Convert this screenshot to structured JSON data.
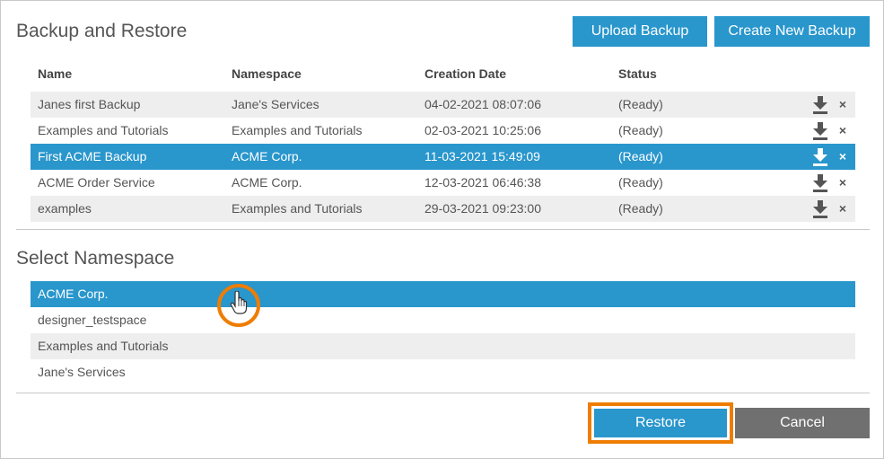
{
  "dialog": {
    "title": "Backup and Restore",
    "upload_label": "Upload Backup",
    "create_label": "Create New Backup"
  },
  "backups": {
    "headers": {
      "name": "Name",
      "namespace": "Namespace",
      "date": "Creation Date",
      "status": "Status"
    },
    "rows": [
      {
        "name": "Janes first Backup",
        "namespace": "Jane's Services",
        "date": "04-02-2021 08:07:06",
        "status": "(Ready)"
      },
      {
        "name": "Examples and Tutorials",
        "namespace": "Examples and Tutorials",
        "date": "02-03-2021 10:25:06",
        "status": "(Ready)"
      },
      {
        "name": "First ACME Backup",
        "namespace": "ACME Corp.",
        "date": "11-03-2021 15:49:09",
        "status": "(Ready)"
      },
      {
        "name": "ACME Order Service",
        "namespace": "ACME Corp.",
        "date": "12-03-2021 06:46:38",
        "status": "(Ready)"
      },
      {
        "name": "examples",
        "namespace": "Examples and Tutorials",
        "date": "29-03-2021 09:23:00",
        "status": "(Ready)"
      }
    ],
    "selected_index": 2,
    "delete_glyph": "×"
  },
  "namespace_section": {
    "title": "Select Namespace",
    "items": [
      "ACME Corp.",
      "designer_testspace",
      "Examples and Tutorials",
      "Jane's Services"
    ],
    "selected_index": 0
  },
  "footer": {
    "restore_label": "Restore",
    "cancel_label": "Cancel"
  },
  "colors": {
    "accent": "#2996cc",
    "highlight": "#ee7d00",
    "cancel": "#707070"
  },
  "icons": {
    "download": "download-icon",
    "delete": "close-icon",
    "pointer": "hand-pointer-icon"
  }
}
